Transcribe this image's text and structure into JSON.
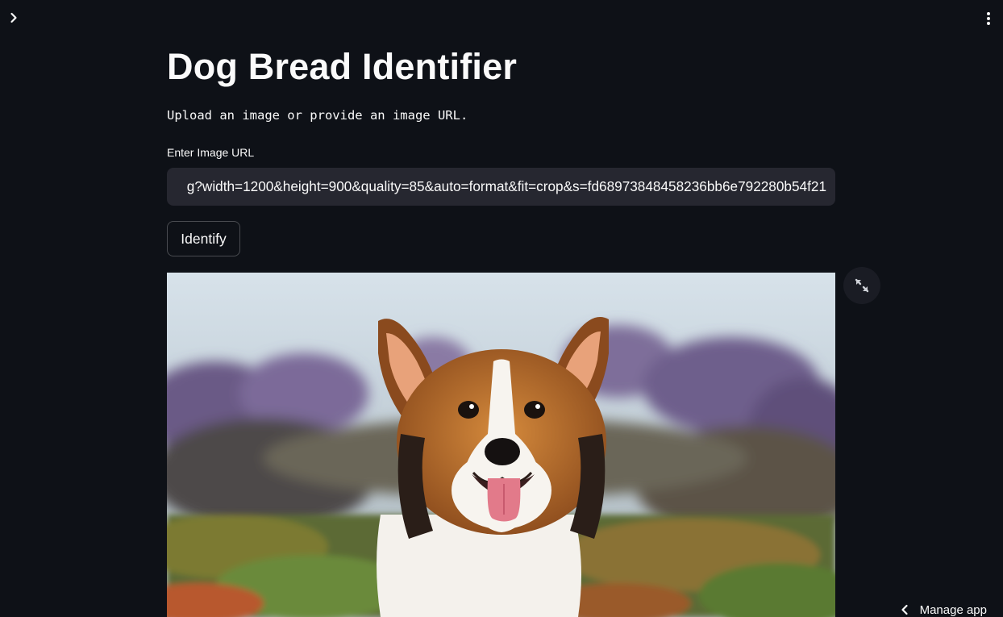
{
  "header": {
    "sidebar_toggle_icon": "chevron-right-icon",
    "menu_icon": "vertical-ellipsis-icon"
  },
  "main": {
    "title": "Dog Bread Identifier",
    "subtitle": "Upload an image or provide an image URL.",
    "url_field": {
      "label": "Enter Image URL",
      "value": "g?width=1200&height=900&quality=85&auto=format&fit=crop&s=fd68973848458236bb6e792280b54f21"
    },
    "identify_button": {
      "label": "Identify"
    },
    "image": {
      "subject": "corgi-dog-photo",
      "fullscreen_icon": "expand-arrows-icon"
    }
  },
  "footer": {
    "manage_app_label": "Manage app",
    "manage_app_icon": "chevron-left-icon"
  },
  "colors": {
    "background": "#0e1117",
    "input_background": "#262730",
    "text": "#fafafa"
  }
}
